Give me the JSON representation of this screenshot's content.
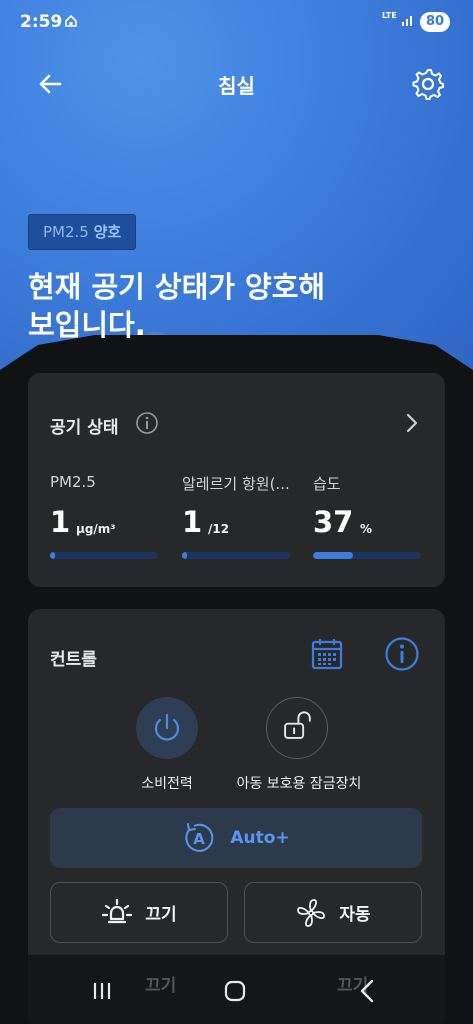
{
  "status_bar": {
    "time": "2:59",
    "network": "LTE",
    "battery": "80",
    "icons": [
      "home-icon",
      "signal-icon"
    ]
  },
  "header": {
    "title": "침실",
    "back_icon": "arrow-left-icon",
    "settings_icon": "gear-icon"
  },
  "hero": {
    "badge_label": "PM2.5",
    "badge_status": "양호",
    "headline_line1": "현재 공기 상태가 양호해",
    "headline_line2": "보입니다."
  },
  "air_status": {
    "title": "공기 상태",
    "metrics": [
      {
        "label": "PM2.5",
        "value": "1",
        "unit": "µg/m³",
        "level": 0.05
      },
      {
        "label": "알레르기 항원(...",
        "value": "1",
        "unit": "/12",
        "level": 0.05
      },
      {
        "label": "습도",
        "value": "37",
        "unit": "%",
        "level": 0.37
      }
    ]
  },
  "control": {
    "title": "컨트롤",
    "power_label": "소비전력",
    "child_lock_label": "아동 보호용 잠금장치",
    "auto_label": "Auto+",
    "light_label": "끄기",
    "fan_label": "자동"
  },
  "bottom": {
    "ghost_light_label": "끄기",
    "ghost_timer_label": "끄기"
  },
  "colors": {
    "accent": "#3d7de0",
    "card": "#272829",
    "background": "#111214"
  }
}
